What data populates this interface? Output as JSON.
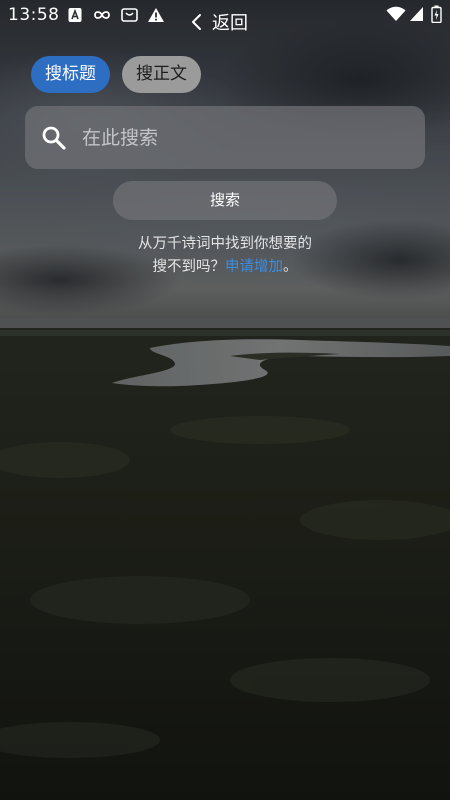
{
  "status_bar": {
    "time": "13:58",
    "icons": [
      "a-icon",
      "infinity-icon",
      "tv-icon",
      "warning-icon",
      "wifi-icon",
      "signal-icon",
      "battery-icon"
    ]
  },
  "nav": {
    "back_label": "返回",
    "back_icon": "chevron-left-icon"
  },
  "tabs": {
    "title_label": "搜标题",
    "body_label": "搜正文",
    "active": "title",
    "active_color": "#2e6ec2"
  },
  "search": {
    "placeholder": "在此搜索",
    "icon": "search-icon",
    "button_label": "搜索"
  },
  "hint": {
    "line1": "从万千诗词中找到你想要的",
    "line2_prefix": "搜不到吗？",
    "link_label": "申请增加",
    "line2_suffix": "。",
    "link_color": "#3a8ee6"
  }
}
